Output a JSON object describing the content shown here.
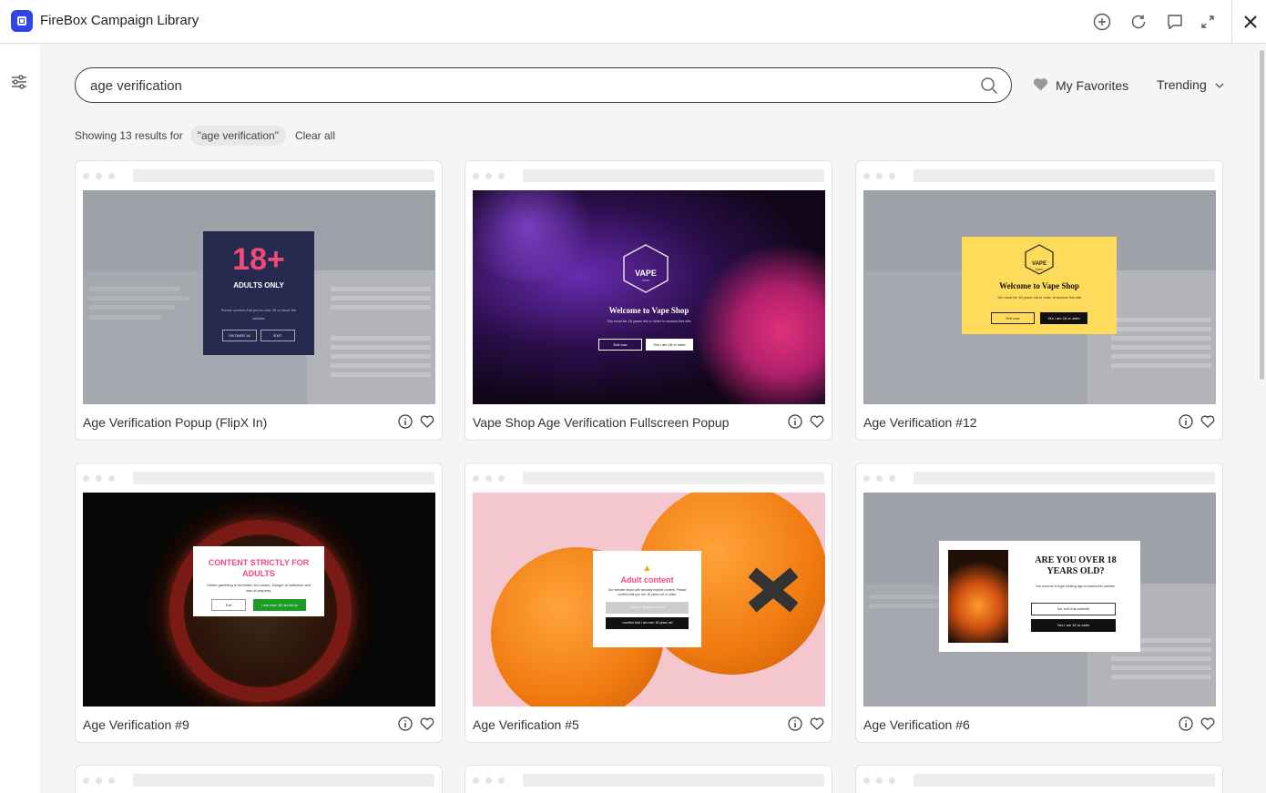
{
  "app": {
    "title": "FireBox Campaign Library"
  },
  "search": {
    "value": "age verification",
    "placeholder": "Search"
  },
  "favorites": {
    "label": "My Favorites"
  },
  "sort": {
    "label": "Trending"
  },
  "results": {
    "prefix": "Showing 13 results for",
    "query_chip": "\"age verification\"",
    "clear_label": "Clear all"
  },
  "cards": [
    {
      "title": "Age Verification Popup (FlipX In)",
      "preview": {
        "headline": "18+",
        "subhead": "ADULTS ONLY",
        "body": "Please confirm that you're over 18 or leave the website",
        "btn1": "I'M OVER 18",
        "btn2": "EXIT"
      }
    },
    {
      "title": "Vape Shop Age Verification Fullscreen Popup",
      "preview": {
        "brand": "VAPE",
        "brand_sub": "SHOP",
        "headline": "Welcome to Vape Shop",
        "body": "You must be 18 years old or older to access this site",
        "btn1": "Exit now",
        "btn2": "Yes I am 18 or older"
      }
    },
    {
      "title": "Age Verification #12",
      "preview": {
        "brand": "VAPE",
        "brand_sub": "SHOP",
        "headline": "Welcome to Vape Shop",
        "body": "You must be 18 years old or older to access this site",
        "btn1": "Exit now",
        "btn2": "Yes I am 18 or older"
      }
    },
    {
      "title": "Age Verification #9",
      "preview": {
        "headline": "CONTENT STRICTLY FOR ADULTS",
        "body": "Online gambling is forbidden for minors. Danger of addiction and loss of property.",
        "btn1": "Exit",
        "btn2": "I am over 18, let me in"
      }
    },
    {
      "title": "Age Verification #5",
      "preview": {
        "headline": "Adult content",
        "body": "Our website deals with sexually explicit content. Please confirm that you are 18 years old or older.",
        "btn1": "I am not 18 years old yet",
        "btn2": "I confirm that I am over 18 years old"
      }
    },
    {
      "title": "Age Verification #6",
      "preview": {
        "headline": "ARE YOU OVER 18 YEARS OLD?",
        "body": "You must be of legal drinking age to access this website.",
        "btn1": "No, exit this website",
        "btn2": "Yes I am 18 or older"
      }
    }
  ],
  "colors": {
    "accent": "#2f45e8",
    "pink": "#f04a78",
    "yellow": "#ffdb5c",
    "green": "#1e9c28"
  }
}
